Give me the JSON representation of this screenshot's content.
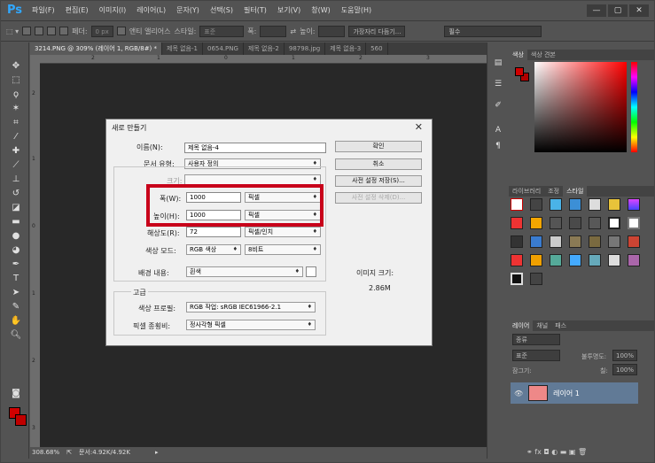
{
  "app": {
    "logo": "Ps",
    "menus": [
      "파일(F)",
      "편집(E)",
      "이미지(I)",
      "레이어(L)",
      "문자(Y)",
      "선택(S)",
      "필터(T)",
      "보기(V)",
      "창(W)",
      "도움말(H)"
    ],
    "win_min": "—",
    "win_max": "▢",
    "win_close": "✕"
  },
  "options": {
    "feather_label": "페더:",
    "feather_value": "0 px",
    "antialias": "앤티 앨리어스",
    "style_label": "스타일:",
    "style_value": "표준",
    "width_label": "폭:",
    "height_label": "높이:",
    "refine": "가장자리 다듬기...",
    "workspace": "필수"
  },
  "tabs": [
    "3214.PNG @ 309% (레이어 1, RGB/8#) *",
    "제목 없음-1",
    "0654.PNG",
    "제목 없음-2",
    "98798.jpg",
    "제목 없음-3",
    "560"
  ],
  "ruler_h": [
    "2",
    "1",
    "0",
    "1",
    "2",
    "3"
  ],
  "ruler_v": [
    "2",
    "1",
    "0",
    "1",
    "2",
    "3"
  ],
  "status": {
    "zoom": "308.68%",
    "doc": "문서:4.92K/4.92K"
  },
  "color_panel": {
    "tab1": "색상",
    "tab2": "색상 견본"
  },
  "styles_panel": {
    "tabs": [
      "라이브러리",
      "조정",
      "스타일"
    ]
  },
  "layers_panel": {
    "tabs": [
      "레이어",
      "채널",
      "패스"
    ],
    "filter": "종류",
    "blend": "표준",
    "opacity_label": "불투명도:",
    "opacity": "100%",
    "lock_label": "잠그기:",
    "fill_label": "칠:",
    "fill": "100%",
    "layer_name": "레이어 1"
  },
  "dialog": {
    "title": "새로 만들기",
    "close": "✕",
    "name_label": "이름(N):",
    "name_value": "제목 없음-4",
    "preset_label": "문서 유형:",
    "preset_value": "사용자 정의",
    "size_label": "크기:",
    "width_label": "폭(W):",
    "width_value": "1000",
    "width_unit": "픽셀",
    "height_label": "높이(H):",
    "height_value": "1000",
    "height_unit": "픽셀",
    "res_label": "해상도(R):",
    "res_value": "72",
    "res_unit": "픽셀/인치",
    "mode_label": "색상 모드:",
    "mode_value": "RGB 색상",
    "depth_value": "8비트",
    "bg_label": "배경 내용:",
    "bg_value": "흰색",
    "adv_label": "고급",
    "profile_label": "색상 프로필:",
    "profile_value": "RGB 작업: sRGB IEC61966-2.1",
    "aspect_label": "픽셀 종횡비:",
    "aspect_value": "정사각형 픽셀",
    "ok": "확인",
    "cancel": "취소",
    "save_preset": "사전 설정 저장(S)...",
    "delete_preset": "사전 설정 삭제(D)...",
    "imgsize_label": "이미지 크기:",
    "imgsize_value": "2.86M"
  }
}
